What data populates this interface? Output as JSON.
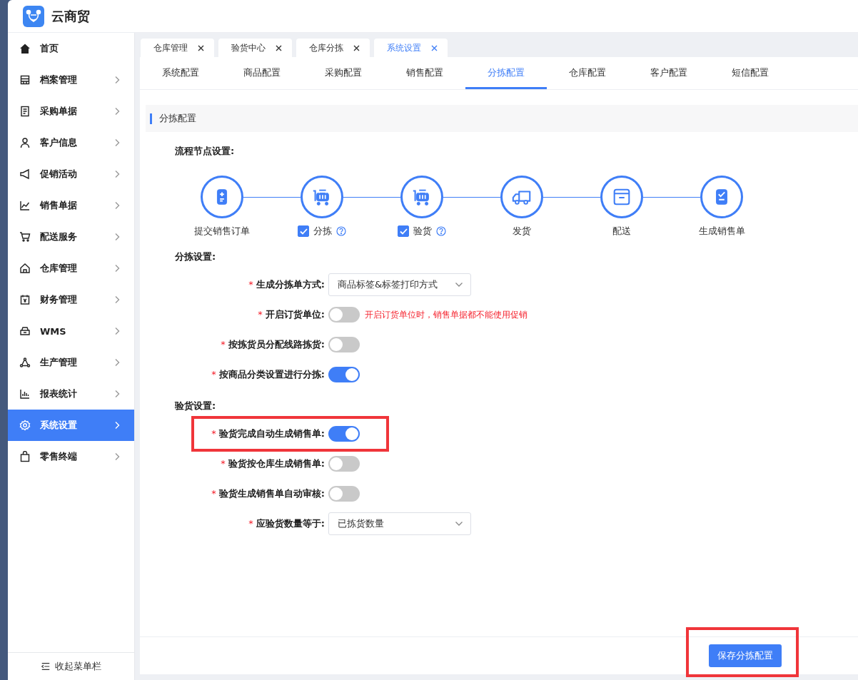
{
  "app": {
    "title": "云商贸"
  },
  "sidebar": {
    "items": [
      {
        "label": "首页",
        "selected": false,
        "expandable": false
      },
      {
        "label": "档案管理",
        "selected": false,
        "expandable": true
      },
      {
        "label": "采购单据",
        "selected": false,
        "expandable": true
      },
      {
        "label": "客户信息",
        "selected": false,
        "expandable": true
      },
      {
        "label": "促销活动",
        "selected": false,
        "expandable": true
      },
      {
        "label": "销售单据",
        "selected": false,
        "expandable": true
      },
      {
        "label": "配送服务",
        "selected": false,
        "expandable": true
      },
      {
        "label": "仓库管理",
        "selected": false,
        "expandable": true
      },
      {
        "label": "财务管理",
        "selected": false,
        "expandable": true
      },
      {
        "label": "WMS",
        "selected": false,
        "expandable": true
      },
      {
        "label": "生产管理",
        "selected": false,
        "expandable": true
      },
      {
        "label": "报表统计",
        "selected": false,
        "expandable": true
      },
      {
        "label": "系统设置",
        "selected": true,
        "expandable": true
      },
      {
        "label": "零售终端",
        "selected": false,
        "expandable": true
      }
    ],
    "collapse_label": "收起菜单栏"
  },
  "page_tabs": [
    {
      "label": "仓库管理",
      "selected": false
    },
    {
      "label": "验货中心",
      "selected": false
    },
    {
      "label": "仓库分拣",
      "selected": false
    },
    {
      "label": "系统设置",
      "selected": true
    }
  ],
  "config_tabs": [
    {
      "label": "系统配置",
      "selected": false
    },
    {
      "label": "商品配置",
      "selected": false
    },
    {
      "label": "采购配置",
      "selected": false
    },
    {
      "label": "销售配置",
      "selected": false
    },
    {
      "label": "分拣配置",
      "selected": true
    },
    {
      "label": "仓库配置",
      "selected": false
    },
    {
      "label": "客户配置",
      "selected": false
    },
    {
      "label": "短信配置",
      "selected": false
    }
  ],
  "section_title": "分拣配置",
  "flow": {
    "heading": "流程节点设置:",
    "steps": [
      {
        "label": "提交销售订单",
        "kind": "plain"
      },
      {
        "label": "分拣",
        "kind": "checkbox",
        "checked": true
      },
      {
        "label": "验货",
        "kind": "checkbox",
        "checked": true
      },
      {
        "label": "发货",
        "kind": "plain"
      },
      {
        "label": "配送",
        "kind": "plain"
      },
      {
        "label": "生成销售单",
        "kind": "plain"
      }
    ]
  },
  "groups": [
    {
      "heading": "分拣设置:",
      "rows": [
        {
          "required_mark": "*",
          "label": "生成分拣单方式:",
          "kind": "select",
          "value": "商品标签&标签打印方式",
          "highlighted": false
        },
        {
          "required_mark": "*",
          "label": "开启订货单位:",
          "kind": "switch",
          "on": false,
          "note": "开启订货单位时，销售单据都不能使用促销",
          "highlighted": false
        },
        {
          "required_mark": "*",
          "label": "按拣货员分配线路拣货:",
          "kind": "switch",
          "on": false,
          "highlighted": false
        },
        {
          "required_mark": "*",
          "label": "按商品分类设置进行分拣:",
          "kind": "switch",
          "on": true,
          "highlighted": false
        }
      ]
    },
    {
      "heading": "验货设置:",
      "rows": [
        {
          "required_mark": "*",
          "label": "验货完成自动生成销售单:",
          "kind": "switch",
          "on": true,
          "highlighted": true
        },
        {
          "required_mark": "*",
          "label": "验货按仓库生成销售单:",
          "kind": "switch",
          "on": false,
          "highlighted": false
        },
        {
          "required_mark": "*",
          "label": "验货生成销售单自动审核:",
          "kind": "switch",
          "on": false,
          "highlighted": false
        },
        {
          "required_mark": "*",
          "label": "应验货数量等于:",
          "kind": "select",
          "value": "已拣货数量",
          "highlighted": false
        }
      ]
    }
  ],
  "save_button": {
    "label": "保存分拣配置",
    "highlighted": true
  }
}
